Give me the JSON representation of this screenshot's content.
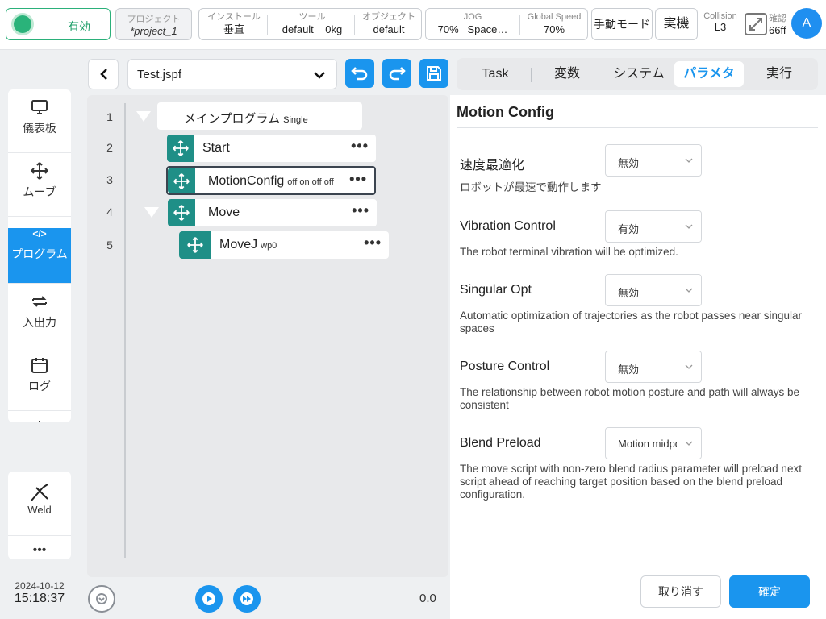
{
  "status": {
    "enabled_label": "有効",
    "color": "#2ab37a"
  },
  "project": {
    "label": "プロジェクト",
    "name": "*project_1"
  },
  "install": {
    "install_label": "インストール",
    "install_value": "垂直",
    "tool_label": "ツール",
    "tool_value": "default",
    "tool_weight": "0kg",
    "object_label": "オブジェクト",
    "object_value": "default"
  },
  "jog": {
    "jog_label": "JOG",
    "jog_value": "70%",
    "jog_space": "Space…",
    "speed_label": "Global Speed",
    "speed_value": "70%"
  },
  "mode": {
    "manual_label": "手動モード",
    "real_label": "実機"
  },
  "collision": {
    "label": "Collision",
    "value": "L3"
  },
  "confirm_mini": {
    "label": "確認",
    "value": "66ff"
  },
  "user": {
    "avatar": "A"
  },
  "nav": {
    "items": [
      {
        "label": "儀表板",
        "icon": "monitor-icon"
      },
      {
        "label": "ムーブ",
        "icon": "move-arrows-icon"
      },
      {
        "label": "プログラム",
        "icon": "code-icon",
        "code": "</>"
      },
      {
        "label": "入出力",
        "icon": "swap-icon"
      },
      {
        "label": "ログ",
        "icon": "calendar-icon"
      },
      {
        "label": "設定",
        "icon": "gear-icon"
      }
    ],
    "weld_label": "Weld",
    "more_label": "•••"
  },
  "datetime": {
    "date": "2024-10-12",
    "time": "15:18:37"
  },
  "program": {
    "file_name": "Test.jspf",
    "lines": [
      "1",
      "2",
      "3",
      "4",
      "5"
    ],
    "main_title": "メインプログラム",
    "main_sub": "Single",
    "nodes": [
      {
        "title": "Start",
        "sub": ""
      },
      {
        "title": "MotionConfig",
        "sub": "off on off off"
      },
      {
        "title": "Move",
        "sub": ""
      },
      {
        "title": "MoveJ",
        "sub": "wp0"
      }
    ],
    "menu_glyph": "•••",
    "speed_value": "0.0"
  },
  "tabs": [
    "Task",
    "変数",
    "システム",
    "パラメタ",
    "実行"
  ],
  "config": {
    "title": "Motion Config",
    "fields": [
      {
        "label": "速度最適化",
        "value": "無効",
        "desc": "ロボットが最速で動作します"
      },
      {
        "label": "Vibration Control",
        "value": "有効",
        "desc": "The robot terminal vibration will be optimized."
      },
      {
        "label": "Singular Opt",
        "value": "無効",
        "desc": "Automatic optimization of trajectories as the robot passes near singular spaces"
      },
      {
        "label": "Posture Control",
        "value": "無効",
        "desc": "The relationship between robot motion posture and path will always be consistent"
      },
      {
        "label": "Blend Preload",
        "value": "Motion midpoint",
        "desc": "The move script with non-zero blend radius parameter will preload next script ahead of reaching target position based on the blend preload configuration."
      }
    ],
    "cancel_label": "取り消す",
    "ok_label": "確定"
  },
  "colors": {
    "accent": "#1a95ee",
    "node_handle": "#1f8f87",
    "enabled": "#2ab37a"
  }
}
